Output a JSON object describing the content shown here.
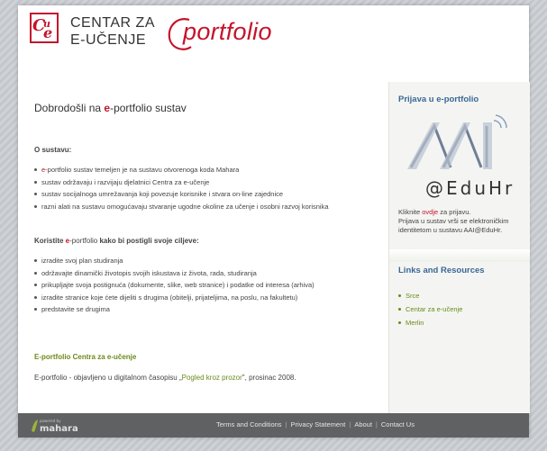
{
  "header": {
    "org_line1": "CENTAR ZA",
    "org_line2": "E-UČENJE",
    "portfolio_word": "portfolio",
    "accent": "#c4142c"
  },
  "main": {
    "welcome_prefix": "Dobrodošli na ",
    "welcome_e": "e",
    "welcome_suffix": "-portfolio sustav",
    "about_title": "O sustavu:",
    "about_items": [
      {
        "red": "e-",
        "text": "portfolio sustav temeljen je na sustavu otvorenoga koda Mahara"
      },
      {
        "red": "",
        "text": "sustav održavaju i razvijaju djelatnici Centra za e-učenje"
      },
      {
        "red": "",
        "text": "sustav socijalnoga umrežavanja koji povezuje korisnike i stvara on-line zajednice"
      },
      {
        "red": "",
        "text": "razni alati na sustavu omogućavaju stvaranje ugodne okoline za učenje i osobni  razvoj korisnika"
      }
    ],
    "goals_title_a": "Koristite ",
    "goals_title_e": "e",
    "goals_title_b": "-portfolio",
    "goals_title_c": " kako bi postigli svoje ciljeve:",
    "goal_items": [
      "izradite svoj plan studiranja",
      "održavajte dinamički životopis svojih iskustava iz života, rada, studiranja",
      "prikupljajte svoja postignuća (dokumente, slike, web stranice) i podatke od interesa (arhiva)",
      "izradite stranice koje ćete dijeliti s drugima (obitelji, prijateljima, na poslu, na fakultetu)",
      "predstavite se drugima"
    ],
    "link_title": "E-portfolio Centra za e-učenje",
    "footer_a": "E-portfolio - objavljeno u digitalnom časopisu „",
    "footer_link": "Pogled kroz prozor",
    "footer_b": "\", prosinac 2008."
  },
  "sidebar": {
    "login_title": "Prijava u e-portfolio",
    "aai_text": "@EduHr",
    "click_a": "Kliknite ",
    "click_link": "ovdje",
    "click_b": " za prijavu.",
    "info": "Prijava u sustav vrši se elektroničkim identitetom u sustavu AAI@EduHr.",
    "links_title": "Links and Resources",
    "links": [
      "Srce",
      "Centar za e-učenje",
      "Merlin"
    ]
  },
  "footer": {
    "brand": "mahara",
    "powered": "powered by",
    "links": [
      "Terms and Conditions",
      "Privacy Statement",
      "About",
      "Contact Us"
    ]
  }
}
